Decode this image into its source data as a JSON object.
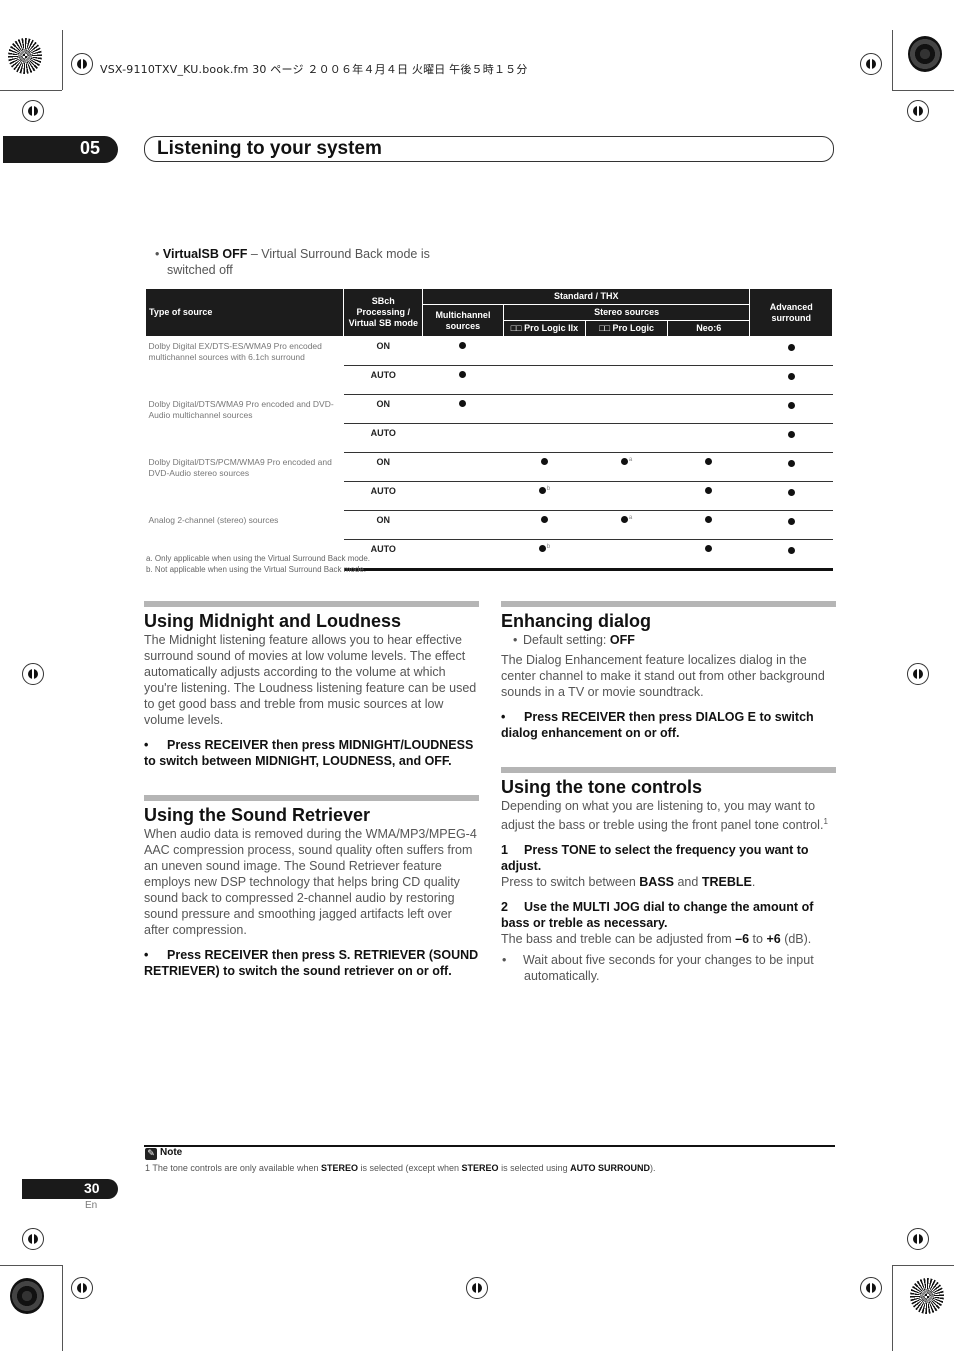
{
  "file_info": "VSX-9110TXV_KU.book.fm  30 ページ  ２００６年４月４日  火曜日  午後５時１５分",
  "chapter": {
    "number": "05",
    "title": "Listening to your system"
  },
  "intro_bullet": {
    "bold": "VirtualSB OFF",
    "text": " – Virtual Surround Back mode is switched off"
  },
  "table": {
    "headers": {
      "type_of_source": "Type of source",
      "sbch_mode": "SBch Processing / Virtual SB mode",
      "standard_thx": "Standard / THX",
      "multichannel": "Multichannel sources",
      "stereo_sources": "Stereo sources",
      "pl2x": "□□ Pro Logic IIx",
      "pl": "□□ Pro Logic",
      "neo6": "Neo:6",
      "advanced": "Advanced surround"
    },
    "groups": [
      {
        "source": "Dolby Digital EX/DTS-ES/WMA9 Pro encoded multichannel sources with 6.1ch surround",
        "rows": [
          {
            "mode": "ON",
            "multi": "●",
            "pl2x": "",
            "pl": "",
            "neo6": "",
            "adv": "●",
            "pl2x_note": "",
            "pl_note": ""
          },
          {
            "mode": "AUTO",
            "multi": "●",
            "pl2x": "",
            "pl": "",
            "neo6": "",
            "adv": "●",
            "pl2x_note": "",
            "pl_note": ""
          }
        ]
      },
      {
        "source": "Dolby Digital/DTS/WMA9 Pro encoded and DVD-Audio multichannel sources",
        "rows": [
          {
            "mode": "ON",
            "multi": "●",
            "pl2x": "",
            "pl": "",
            "neo6": "",
            "adv": "●",
            "pl2x_note": "",
            "pl_note": ""
          },
          {
            "mode": "AUTO",
            "multi": "",
            "pl2x": "",
            "pl": "",
            "neo6": "",
            "adv": "●",
            "pl2x_note": "",
            "pl_note": ""
          }
        ]
      },
      {
        "source": "Dolby Digital/DTS/PCM/WMA9 Pro encoded and DVD-Audio stereo sources",
        "rows": [
          {
            "mode": "ON",
            "multi": "",
            "pl2x": "●",
            "pl": "●",
            "neo6": "●",
            "adv": "●",
            "pl2x_note": "",
            "pl_note": "a"
          },
          {
            "mode": "AUTO",
            "multi": "",
            "pl2x": "●",
            "pl": "",
            "neo6": "●",
            "adv": "●",
            "pl2x_note": "b",
            "pl_note": ""
          }
        ]
      },
      {
        "source": "Analog 2-channel (stereo) sources",
        "rows": [
          {
            "mode": "ON",
            "multi": "",
            "pl2x": "●",
            "pl": "●",
            "neo6": "●",
            "adv": "●",
            "pl2x_note": "",
            "pl_note": "a"
          },
          {
            "mode": "AUTO",
            "multi": "",
            "pl2x": "●",
            "pl": "",
            "neo6": "●",
            "adv": "●",
            "pl2x_note": "b",
            "pl_note": ""
          }
        ]
      }
    ],
    "notes": [
      "a. Only applicable when using the Virtual Surround Back mode.",
      "b. Not applicable when using the Virtual Surround Back mode."
    ]
  },
  "sections": {
    "midnight": {
      "title": "Using Midnight and Loudness",
      "body": "The Midnight listening feature allows you to hear effective surround sound of movies at low volume levels. The effect automatically adjusts according to the volume at which you're listening. The Loudness listening feature can be used to get good bass and treble from music sources at low volume levels.",
      "instruction": "Press RECEIVER then press MIDNIGHT/LOUDNESS to switch between MIDNIGHT, LOUDNESS, and OFF."
    },
    "retriever": {
      "title": "Using the Sound Retriever",
      "body": "When audio data is removed during the WMA/MP3/MPEG-4 AAC compression process, sound quality often suffers from an uneven sound image. The Sound Retriever feature employs new DSP technology that helps bring CD quality sound back to compressed 2-channel audio by restoring sound pressure and smoothing jagged artifacts left over after compression.",
      "instruction": "Press RECEIVER then press S. RETRIEVER (SOUND RETRIEVER) to switch the sound retriever on or off."
    },
    "dialog": {
      "title": "Enhancing dialog",
      "default_label": "Default setting: ",
      "default_value": "OFF",
      "body": "The Dialog Enhancement feature localizes dialog in the center channel to make it stand out from other background sounds in a TV or movie soundtrack.",
      "instruction": "Press RECEIVER then press DIALOG E to switch dialog enhancement on or off."
    },
    "tone": {
      "title": "Using the tone controls",
      "body": "Depending on what you are listening to, you may want to adjust the bass or treble using the front panel tone control.",
      "footnote_ref": "1",
      "step1_num": "1",
      "step1": "Press TONE to select the frequency you want to adjust.",
      "step1_detail_pre": "Press to switch between ",
      "step1_bass": "BASS",
      "step1_and": " and ",
      "step1_treble": "TREBLE",
      "step1_end": ".",
      "step2_num": "2",
      "step2": "Use the MULTI JOG dial to change the amount of bass or treble as necessary.",
      "step2_detail_pre": "The bass and treble can be adjusted from ",
      "step2_min": "–6",
      "step2_to": " to ",
      "step2_max": "+6",
      "step2_end": " (dB).",
      "step2_sub": "Wait about five seconds for your changes to be input automatically."
    }
  },
  "note": {
    "title": "Note",
    "num": "1",
    "t1": " The tone controls are only available when ",
    "b1": "STEREO",
    "t2": " is selected (except when ",
    "b2": "STEREO",
    "t3": " is selected using ",
    "b3": "AUTO SURROUND",
    "t4": ")."
  },
  "page": {
    "number": "30",
    "lang": "En"
  }
}
